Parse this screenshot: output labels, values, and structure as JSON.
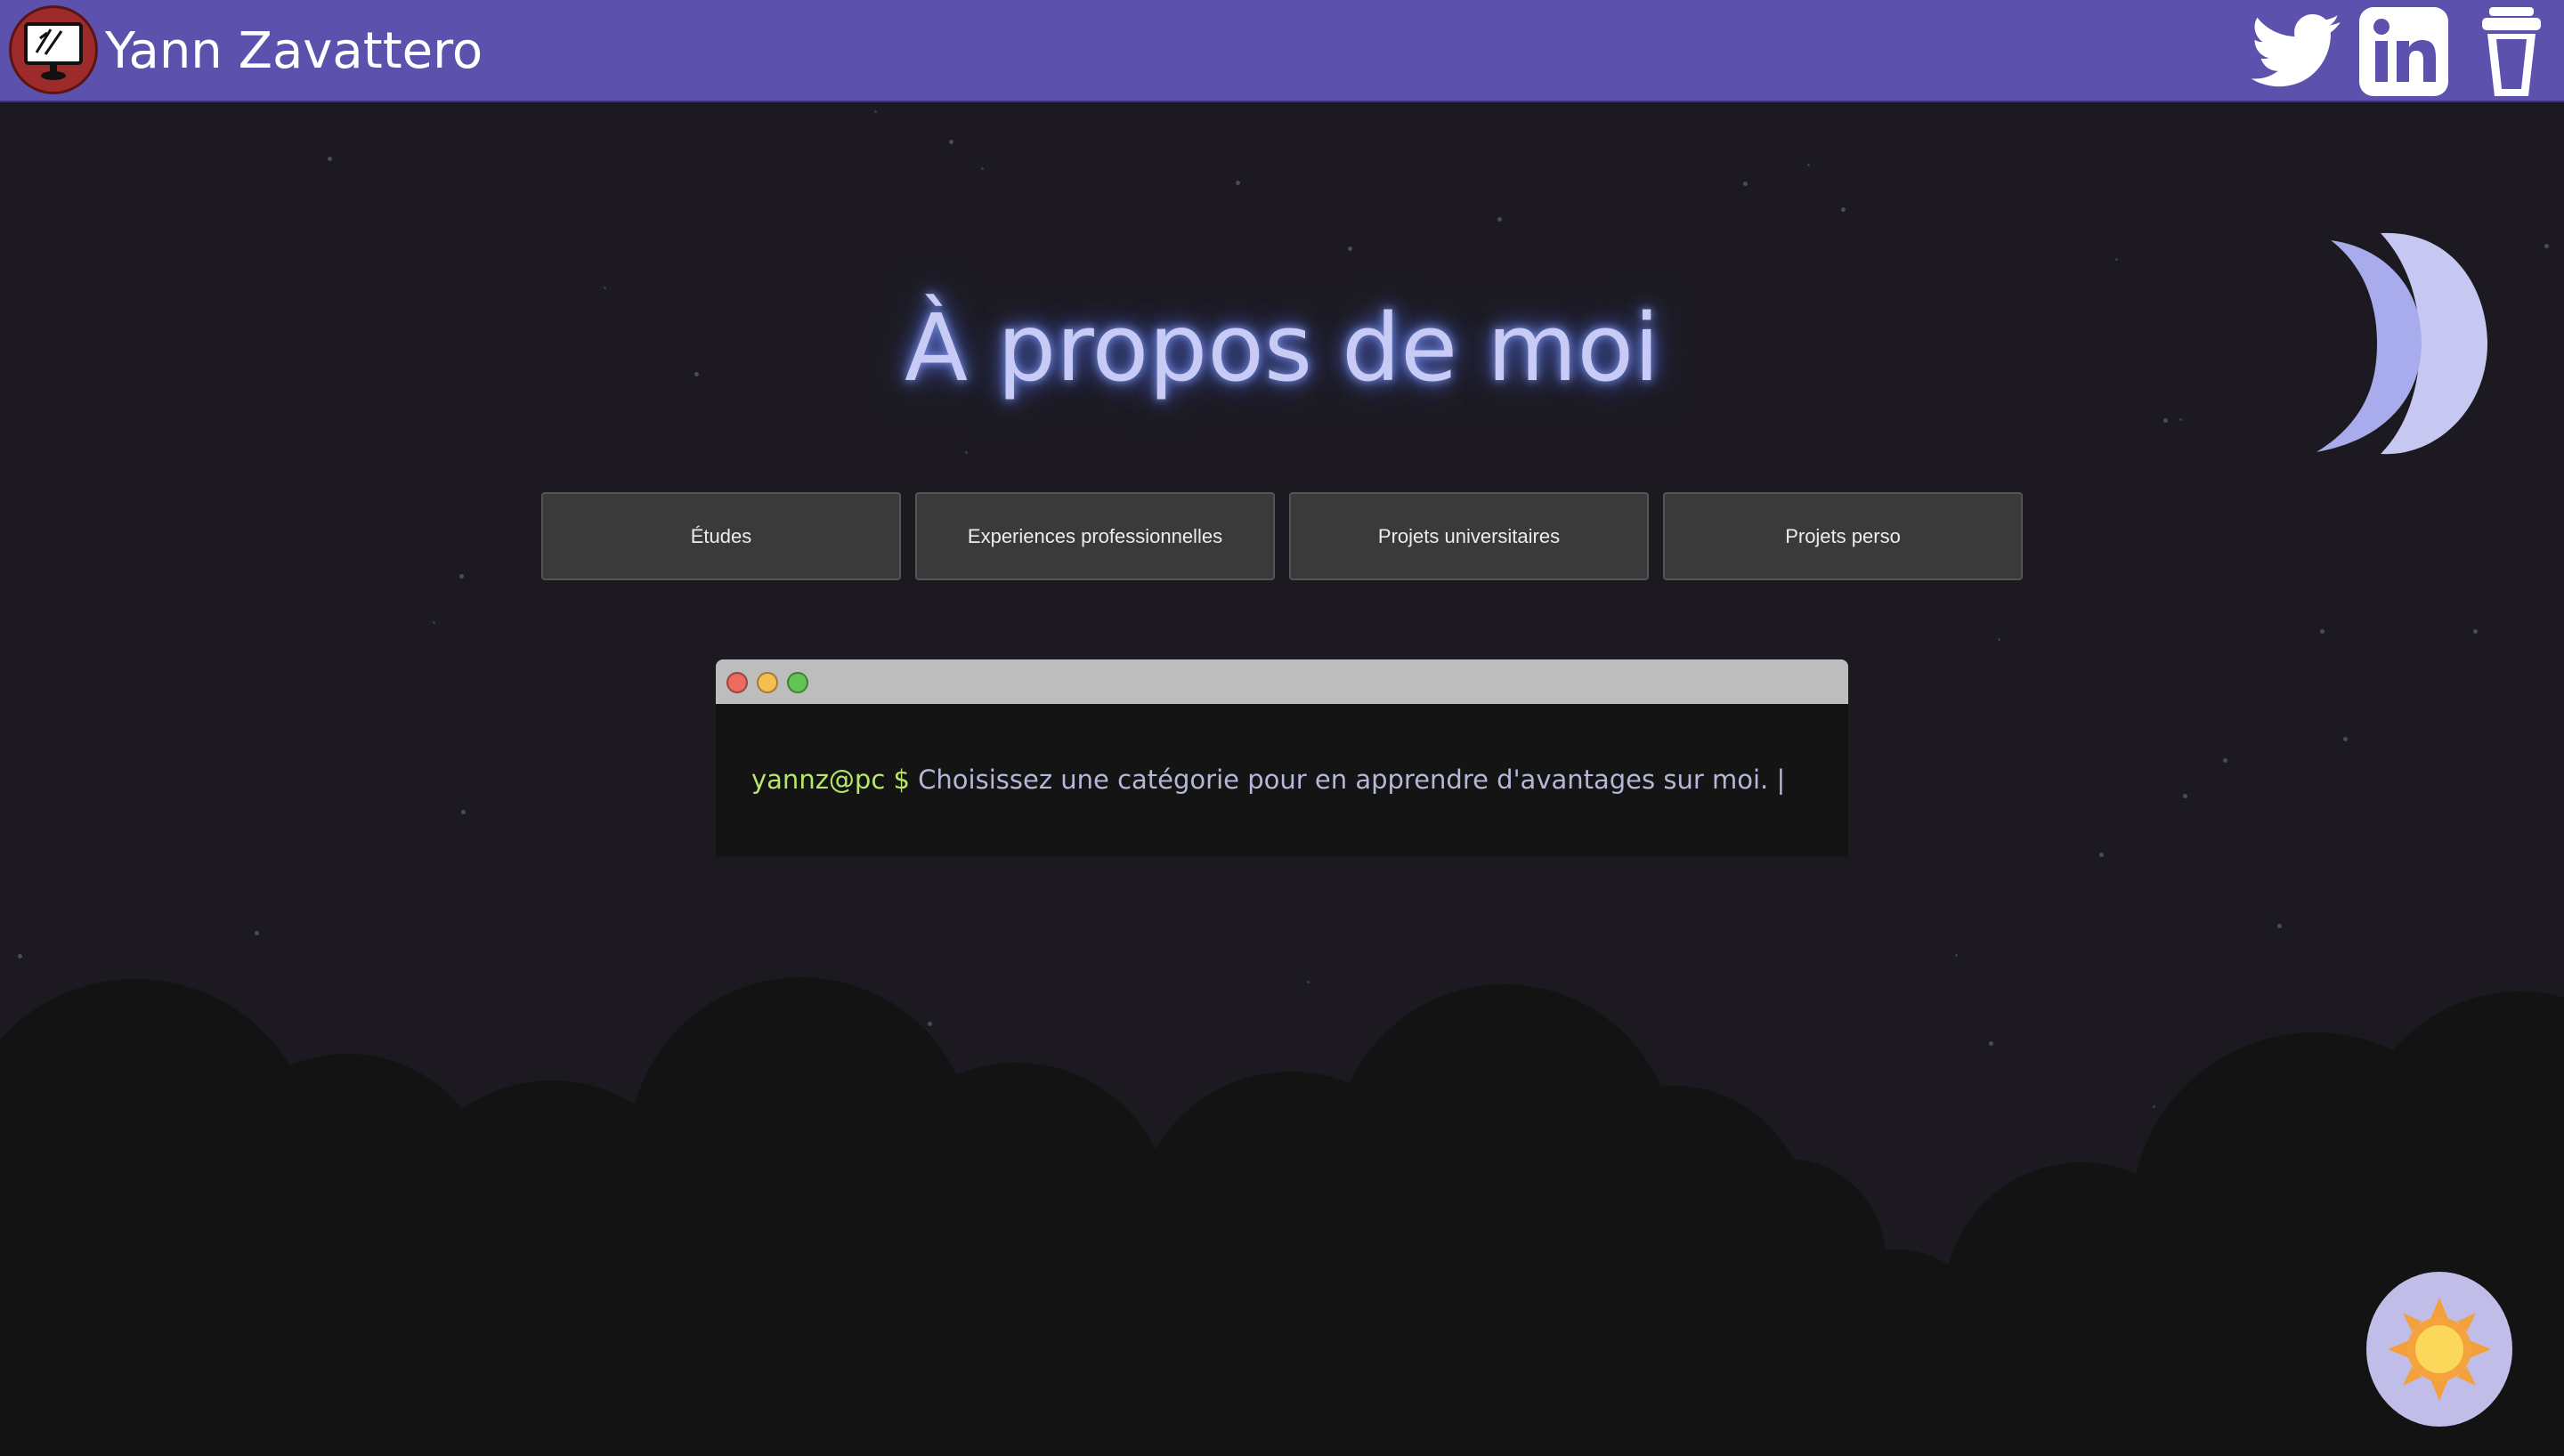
{
  "header": {
    "site_title": "Yann Zavattero",
    "social_icons": [
      "twitter-icon",
      "linkedin-icon",
      "coffee-cup-icon"
    ]
  },
  "main": {
    "title": "À propos de moi",
    "categories": [
      {
        "label": "Études"
      },
      {
        "label": "Experiences professionnelles"
      },
      {
        "label": "Projets universitaires"
      },
      {
        "label": "Projets perso"
      }
    ]
  },
  "terminal": {
    "prompt_user": "yannz@pc",
    "prompt_symbol": "$",
    "message": "Choisissez une catégorie pour en apprendre d'avantages sur moi.",
    "cursor": "|"
  },
  "theme_toggle": {
    "icon": "sun-icon"
  },
  "colors": {
    "header_bg": "#5c52ae",
    "page_bg": "#1c1a20",
    "title_text": "#c7cbf5",
    "prompt_green": "#b5e86a",
    "moon": "#c7caf3"
  }
}
